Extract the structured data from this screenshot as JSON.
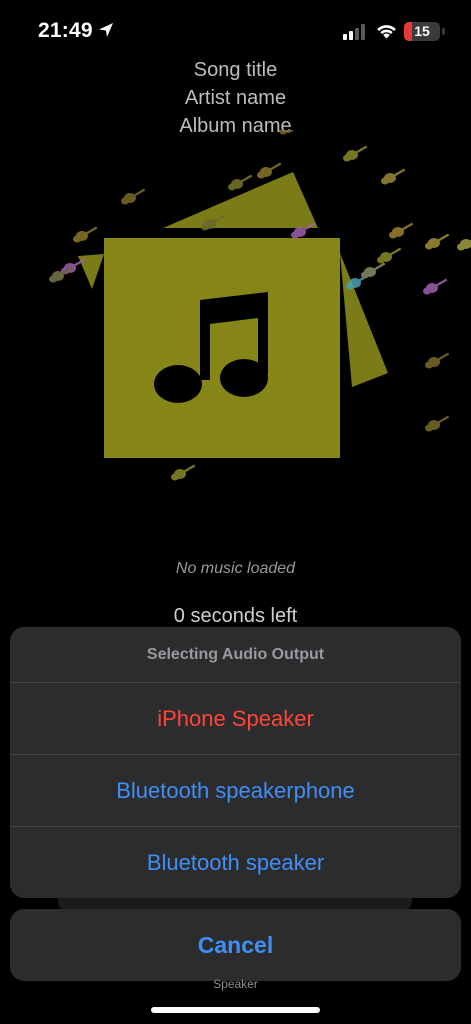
{
  "status_bar": {
    "time": "21:49",
    "battery_level": "15",
    "battery_color": "#e53935",
    "icons": [
      "location-arrow-icon",
      "cellular-signal-icon",
      "wifi-icon",
      "battery-icon"
    ]
  },
  "now_playing": {
    "song_title": "Song title",
    "artist_name": "Artist name",
    "album_name": "Album name",
    "artwork_icon": "music-note-icon",
    "artwork_color": "#868618",
    "status": "No music loaded",
    "time_left": "0 seconds left"
  },
  "action_sheet": {
    "title": "Selecting Audio Output",
    "options": [
      {
        "label": "iPhone Speaker",
        "color": "#ff453a"
      },
      {
        "label": "Bluetooth speakerphone",
        "color": "#3f8ff5"
      },
      {
        "label": "Bluetooth speaker",
        "color": "#3f8ff5"
      }
    ],
    "cancel_label": "Cancel"
  },
  "footer": {
    "label": "Speaker"
  }
}
